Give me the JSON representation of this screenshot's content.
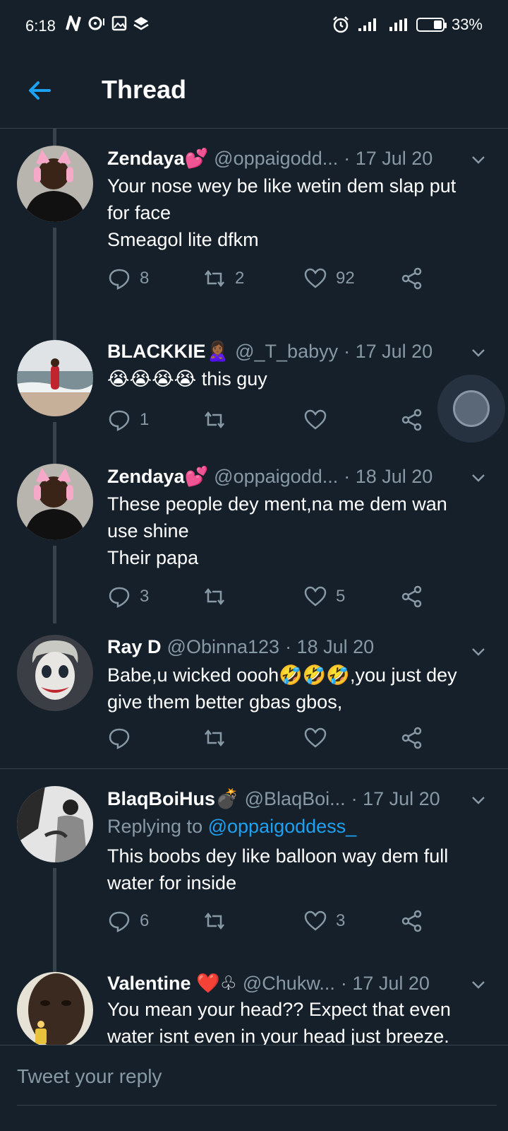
{
  "status_bar": {
    "time": "6:18",
    "battery": "33%",
    "battery_level": 0.33
  },
  "header": {
    "title": "Thread"
  },
  "tweets": [
    {
      "name": "Zendaya💕",
      "handle": "@oppaigodd...",
      "date": "· 17 Jul 20",
      "reply_to_prefix": "",
      "reply_to_mention": "",
      "text": [
        "Your nose wey be like wetin dem slap put",
        "for face",
        "Smeagol lite dfkm"
      ],
      "replies": "8",
      "retweets": "2",
      "likes": "92"
    },
    {
      "name": "BLACKKIE🙎🏾‍♀️",
      "handle": "@_T_babyy",
      "date": "· 17 Jul 20",
      "reply_to_prefix": "",
      "reply_to_mention": "",
      "text": [
        "😭😭😭😭 this guy"
      ],
      "replies": "1",
      "retweets": "",
      "likes": ""
    },
    {
      "name": "Zendaya💕",
      "handle": "@oppaigodd...",
      "date": "· 18 Jul 20",
      "reply_to_prefix": "",
      "reply_to_mention": "",
      "text": [
        "These people dey ment,na me dem wan",
        "use shine",
        "Their papa"
      ],
      "replies": "3",
      "retweets": "",
      "likes": "5"
    },
    {
      "name": "Ray D",
      "handle": "@Obinna123",
      "date": "· 18 Jul 20",
      "reply_to_prefix": "",
      "reply_to_mention": "",
      "text": [
        "Babe,u wicked oooh🤣🤣🤣,you just dey",
        "give them better gbas gbos,"
      ],
      "replies": "",
      "retweets": "",
      "likes": ""
    },
    {
      "name": "BlaqBoiHus💣",
      "handle": "@BlaqBoi...",
      "date": "· 17 Jul 20",
      "reply_to_prefix": "Replying to",
      "reply_to_mention": "@oppaigoddess_",
      "text": [
        "This boobs dey like balloon way dem full",
        "water for inside"
      ],
      "replies": "6",
      "retweets": "",
      "likes": "3"
    },
    {
      "name": "Valentine ❤️♧",
      "handle": "@Chukw...",
      "date": "· 17 Jul 20",
      "reply_to_prefix": "",
      "reply_to_mention": "",
      "text": [
        "You mean your head?? Expect that even",
        "water isnt even in your head just breeze."
      ],
      "replies": "",
      "retweets": "",
      "likes": ""
    }
  ],
  "reply_bar": {
    "placeholder": "Tweet your reply"
  },
  "colors": {
    "background": "#15202b",
    "accent": "#1da1f2",
    "muted": "#8899a6",
    "divider": "#38444d"
  }
}
